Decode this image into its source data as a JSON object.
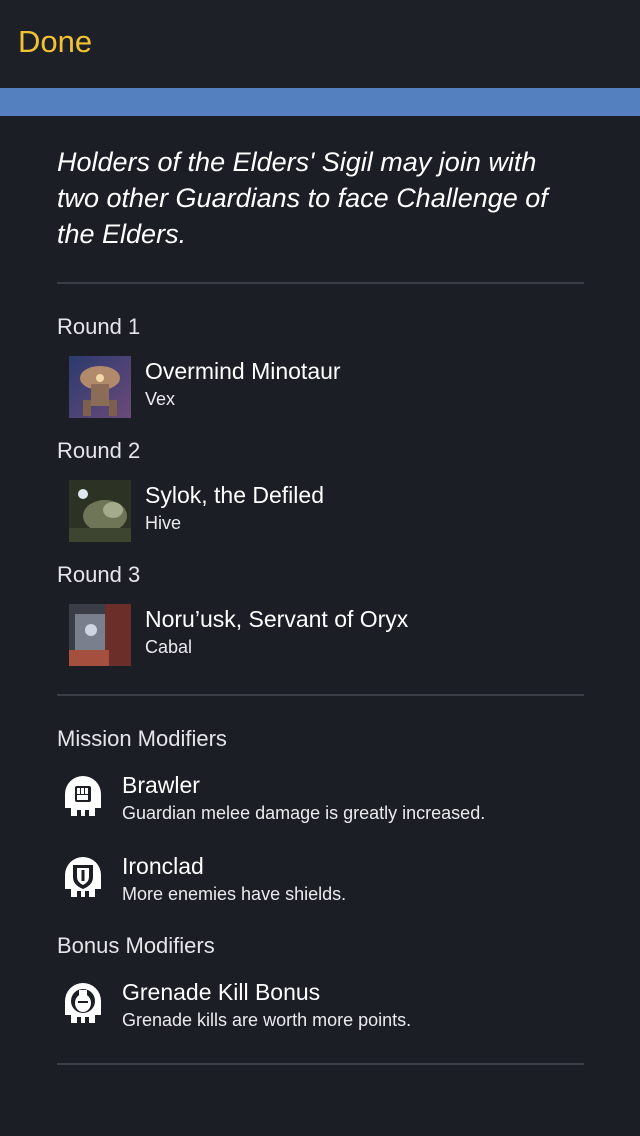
{
  "nav": {
    "done_label": "Done"
  },
  "intro": "Holders of the Elders' Sigil may join with two other Guardians to face Challenge of the Elders.",
  "rounds": [
    {
      "heading": "Round 1",
      "name": "Overmind Minotaur",
      "faction": "Vex"
    },
    {
      "heading": "Round 2",
      "name": "Sylok, the Defiled",
      "faction": "Hive"
    },
    {
      "heading": "Round 3",
      "name": "Noru’usk, Servant of Oryx",
      "faction": "Cabal"
    }
  ],
  "mission_modifiers": {
    "heading": "Mission Modifiers",
    "items": [
      {
        "name": "Brawler",
        "description": "Guardian melee damage is greatly increased.",
        "icon": "fist-icon"
      },
      {
        "name": "Ironclad",
        "description": "More enemies have shields.",
        "icon": "shield-icon"
      }
    ]
  },
  "bonus_modifiers": {
    "heading": "Bonus Modifiers",
    "items": [
      {
        "name": "Grenade Kill Bonus",
        "description": "Grenade kills are worth more points.",
        "icon": "grenade-icon"
      }
    ]
  },
  "colors": {
    "accent": "#f2c233",
    "bar": "#5580c0",
    "background": "#1b1e25"
  }
}
